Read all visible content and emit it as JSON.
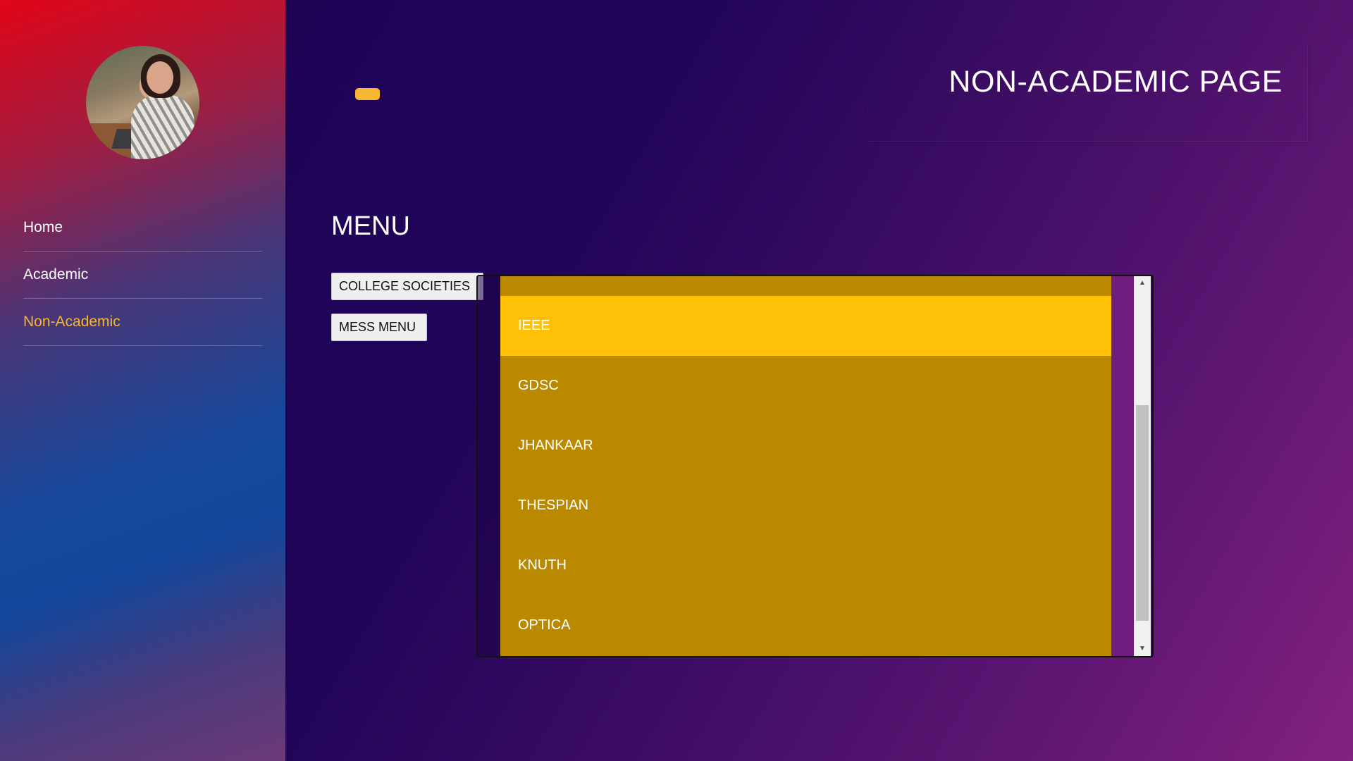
{
  "sidebar": {
    "avatar_alt": "profile photo",
    "nav": [
      {
        "label": "Home"
      },
      {
        "label": "Academic"
      },
      {
        "label": "Non-Academic"
      }
    ]
  },
  "header": {
    "title": "NON-ACADEMIC PAGE"
  },
  "main": {
    "heading": "MENU",
    "buttons": {
      "societies": "COLLEGE SOCIETIES",
      "mess": "MESS MENU"
    },
    "societies_list": [
      "IEEE",
      "GDSC",
      "JHANKAAR",
      "THESPIAN",
      "KNUTH",
      "OPTICA"
    ],
    "active_item": "IEEE"
  },
  "icons": {
    "scroll_up": "chevron-up-icon",
    "scroll_down": "chevron-down-icon"
  },
  "colors": {
    "accent": "#f7b733",
    "active_item": "#ffc107",
    "list_bg": "#bb8900"
  }
}
